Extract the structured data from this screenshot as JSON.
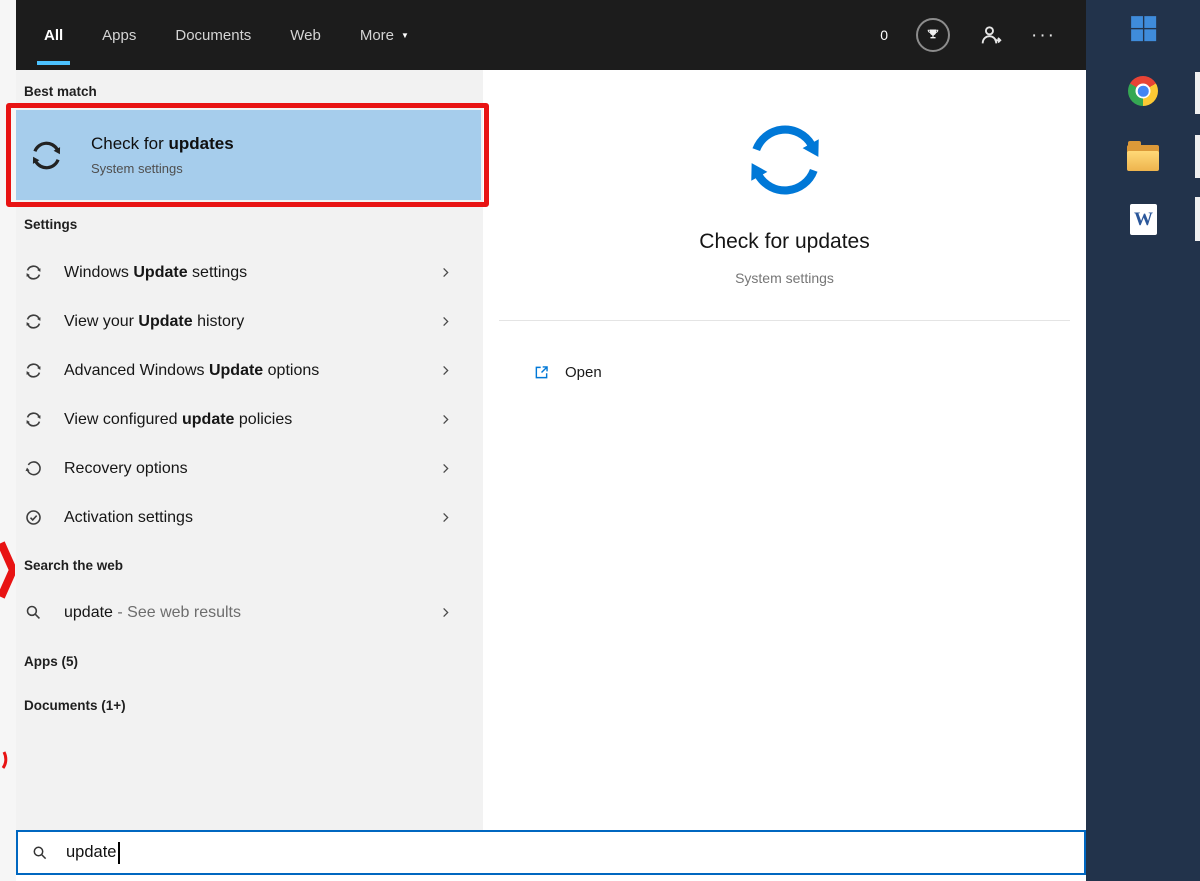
{
  "topbar": {
    "tabs": [
      {
        "label": "All"
      },
      {
        "label": "Apps"
      },
      {
        "label": "Documents"
      },
      {
        "label": "Web"
      },
      {
        "label": "More"
      }
    ],
    "more_arrow": "▼",
    "rewards_count": "0",
    "ellipsis": "···"
  },
  "left": {
    "best_match_header": "Best match",
    "best_match": {
      "title_pre": "Check for ",
      "title_bold": "updates",
      "subtitle": "System settings"
    },
    "settings_header": "Settings",
    "settings_items": [
      {
        "pre": "Windows ",
        "bold": "Update",
        "post": " settings"
      },
      {
        "pre": "View your ",
        "bold": "Update",
        "post": " history"
      },
      {
        "pre": "Advanced Windows ",
        "bold": "Update",
        "post": " options"
      },
      {
        "pre": "View configured ",
        "bold": "update",
        "post": " policies"
      },
      {
        "pre": "Recovery options",
        "bold": "",
        "post": ""
      },
      {
        "pre": "Activation settings",
        "bold": "",
        "post": ""
      }
    ],
    "web_header": "Search the web",
    "web_item": {
      "term": "update",
      "rest": " - See web results"
    },
    "apps_header": "Apps (5)",
    "documents_header": "Documents (1+)"
  },
  "preview": {
    "title": "Check for updates",
    "subtitle": "System settings",
    "open_label": "Open"
  },
  "searchbox": {
    "value": "update"
  },
  "taskbar": {
    "word_glyph": "W"
  },
  "colors": {
    "accent": "#0078d7",
    "highlight": "#a6cdec",
    "annotation": "#e81313",
    "taskbar_bg": "#22334b",
    "tab_underline": "#4cc2ff",
    "panel_bg": "#f2f2f2",
    "topbar_bg": "#1c1c1c"
  }
}
